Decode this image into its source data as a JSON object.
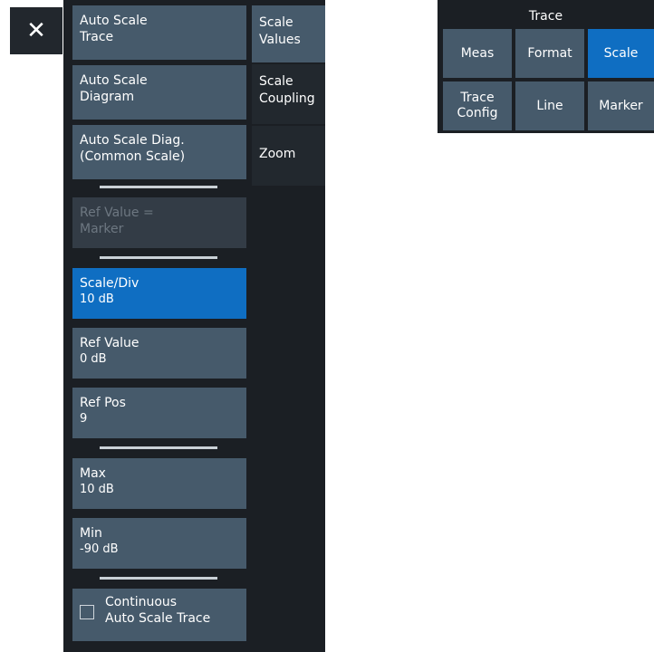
{
  "close": {
    "glyph": "✕"
  },
  "left_menu": {
    "auto_scale_trace": [
      "Auto Scale",
      "Trace"
    ],
    "auto_scale_diagram": [
      "Auto Scale",
      "Diagram"
    ],
    "auto_scale_diag_common": [
      "Auto Scale Diag.",
      "(Common Scale)"
    ],
    "ref_value_marker": [
      "Ref Value =",
      "Marker"
    ],
    "scale_div": {
      "label": "Scale/Div",
      "value": "10 dB"
    },
    "ref_value": {
      "label": "Ref Value",
      "value": "0 dB"
    },
    "ref_pos": {
      "label": "Ref Pos",
      "value": "9"
    },
    "max": {
      "label": "Max",
      "value": "10 dB"
    },
    "min": {
      "label": "Min",
      "value": "-90 dB"
    },
    "continuous": [
      "Continuous",
      "Auto Scale Trace"
    ]
  },
  "tabs": {
    "scale_values": [
      "Scale",
      "Values"
    ],
    "scale_coupling": [
      "Scale",
      "Coupling"
    ],
    "zoom": [
      "Zoom"
    ]
  },
  "trace_panel": {
    "title": "Trace",
    "buttons": {
      "meas": [
        "Meas"
      ],
      "format": [
        "Format"
      ],
      "scale": [
        "Scale"
      ],
      "trace_config": [
        "Trace",
        "Config"
      ],
      "line": [
        "Line"
      ],
      "marker": [
        "Marker"
      ]
    }
  },
  "colors": {
    "panel_bg": "#1b1f24",
    "button_bg": "#465a6b",
    "active_bg": "#0f6ec2",
    "disabled_text": "#6d7781"
  }
}
